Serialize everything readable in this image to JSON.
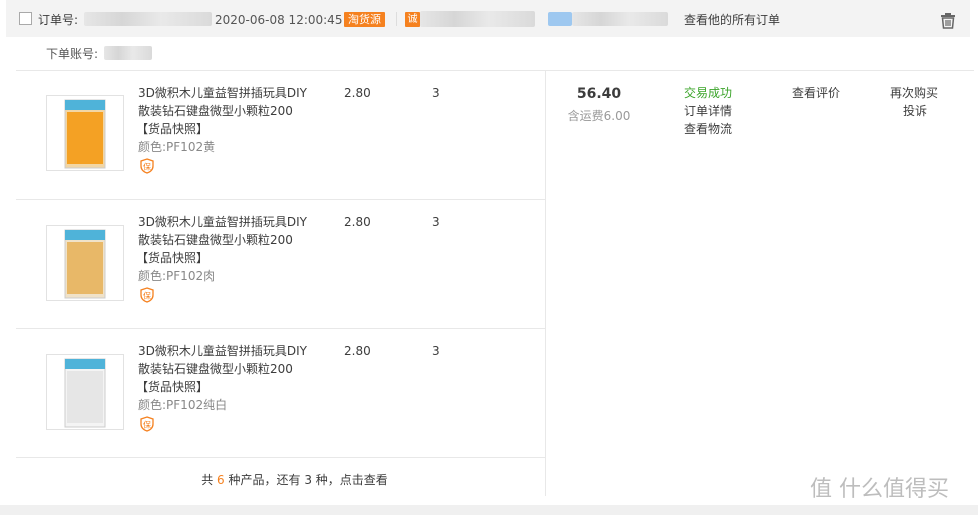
{
  "header": {
    "order_label": "订单号:",
    "datetime": "2020-06-08 12:00:45",
    "source_badge": "淘货源",
    "cheng_badge": "诚",
    "view_all_link": "查看他的所有订单",
    "account_label": "下单账号:"
  },
  "products": [
    {
      "name_line1": "3D微积木儿童益智拼插玩具DIY",
      "name_line2": "散装钻石键盘微型小颗粒200",
      "snapshot": "【货品快照】",
      "color": "颜色:PF102黄",
      "price": "2.80",
      "qty": "3",
      "bao_icon": "保"
    },
    {
      "name_line1": "3D微积木儿童益智拼插玩具DIY",
      "name_line2": "散装钻石键盘微型小颗粒200",
      "snapshot": "【货品快照】",
      "color": "颜色:PF102肉",
      "price": "2.80",
      "qty": "3",
      "bao_icon": "保"
    },
    {
      "name_line1": "3D微积木儿童益智拼插玩具DIY",
      "name_line2": "散装钻石键盘微型小颗粒200",
      "snapshot": "【货品快照】",
      "color": "颜色:PF102纯白",
      "price": "2.80",
      "qty": "3",
      "bao_icon": "保"
    }
  ],
  "summary": {
    "total": "56.40",
    "shipping": "含运费6.00",
    "status": "交易成功",
    "order_detail": "订单详情",
    "view_logistics": "查看物流",
    "view_review": "查看评价",
    "buy_again": "再次购买",
    "complain": "投诉"
  },
  "footer": {
    "prefix": "共 ",
    "count": "6",
    "mid": " 种产品，还有 3 种，点击查看"
  },
  "watermark": "值 什么值得买",
  "colors": {
    "accent": "#f5811f",
    "success": "#3ba42a",
    "header_bg": "#f3f3f3"
  }
}
